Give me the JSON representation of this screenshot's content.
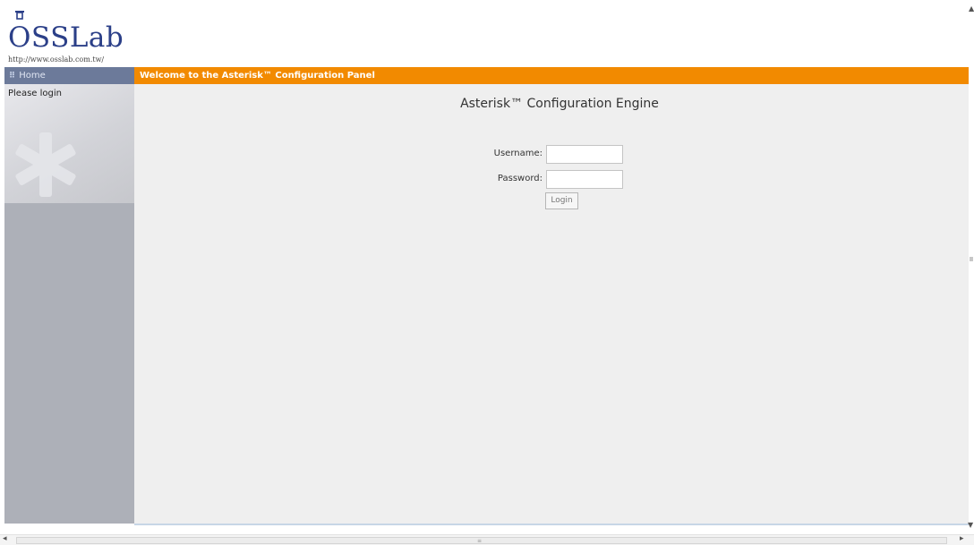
{
  "logo": {
    "brand": "OSSLab",
    "url": "http://www.osslab.com.tw/",
    "flask_icon": "flask-icon"
  },
  "nav": {
    "home_label": "Home",
    "grip_icon": "grip-icon"
  },
  "header": {
    "welcome": "Welcome to the Asterisk™ Configuration Panel"
  },
  "sidebar": {
    "login_note": "Please login",
    "watermark_icon": "asterisk-icon"
  },
  "main": {
    "title": "Asterisk™ Configuration Engine",
    "username_label": "Username:",
    "username_value": "",
    "password_label": "Password:",
    "password_value": "",
    "login_button": "Login"
  },
  "colors": {
    "accent_bar": "#f28a00",
    "nav_bar": "#6c7a9a",
    "sidebar": "#adb0b8",
    "content_bg": "#efefef",
    "brand": "#2b3f88"
  }
}
